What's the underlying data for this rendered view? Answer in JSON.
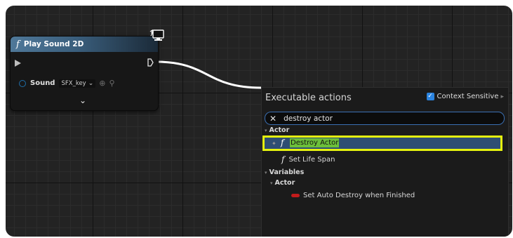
{
  "node": {
    "func_glyph": "f",
    "title": "Play Sound 2D",
    "pin_label": "Sound",
    "pin_value": "SFX_key",
    "pin_chevron": "⌄",
    "pin_icons": [
      "⊕",
      "⚲"
    ],
    "expand_glyph": "⌄",
    "header_color": "#4f7899",
    "icons": [
      "function-icon",
      "exec-in-pin-icon",
      "exec-out-pin-icon",
      "object-pin-icon",
      "use-selected-icon",
      "browse-icon",
      "expand-icon",
      "monitor-icon"
    ]
  },
  "menu": {
    "title": "Executable actions",
    "context_label": "Context Sensitive",
    "context_checked": true,
    "check_glyph": "✓",
    "context_arrow": "▸",
    "search_clear": "✕",
    "search_value": "destroy actor",
    "tree_toggle": "▾",
    "categories": {
      "actor": "Actor",
      "variables": "Variables",
      "variables_actor": "Actor"
    },
    "items": {
      "destroy_actor": "Destroy Actor",
      "set_life_span": "Set Life Span",
      "set_auto_destroy": "Set Auto Destroy when Finished"
    },
    "selected_star": "✦",
    "highlight_color": "#e5f20f",
    "match_color": "#6cbf3a",
    "selection_color": "#2e4e73"
  }
}
